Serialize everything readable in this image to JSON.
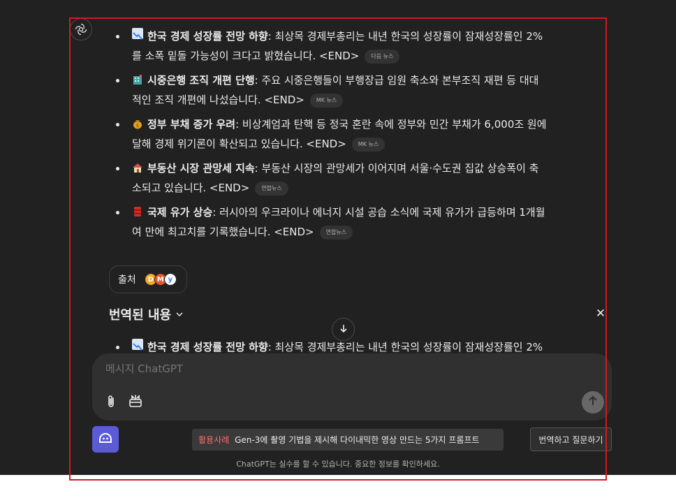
{
  "news_items": [
    {
      "emoji": "chart-decreasing",
      "emoji_color": "#3b82f6",
      "title": "한국 경제 성장률 전망 하향",
      "line1": ": 최상목 경제부총리는 내년 한국의 성장률이 잠재성장률인 2%",
      "line2": "를 소폭 밑돌 가능성이 크다고 밝혔습니다. <END>",
      "source": "다음 뉴스"
    },
    {
      "emoji": "bank-building",
      "emoji_color": "#4aa3a3",
      "title": "시중은행 조직 개편 단행",
      "line1": ": 주요 시중은행들이 부행장급 임원 축소와 본부조직 재편 등 대대",
      "line2": "적인 조직 개편에 나섰습니다. <END>",
      "source": "MK 뉴스"
    },
    {
      "emoji": "money-bag",
      "emoji_color": "#e0a020",
      "title": "정부 부채 증가 우려",
      "line1": ": 비상계엄과 탄핵 등 정국 혼란 속에 정부와 민간 부채가 6,000조 원에",
      "line2": "달해 경제 위기론이 확산되고 있습니다. <END>",
      "source": "MK 뉴스"
    },
    {
      "emoji": "house",
      "emoji_color": "#e8a060",
      "title": "부동산 시장 관망세 지속",
      "line1": ": 부동산 시장의 관망세가 이어지며 서울·수도권 집값 상승폭이 축",
      "line2": "소되고 있습니다. <END>",
      "source": "연합뉴스"
    },
    {
      "emoji": "oil-drum",
      "emoji_color": "#d42a2a",
      "title": "국제 유가 상승",
      "line1": ": 러시아의 우크라이나 에너지 시설 공습 소식에 국제 유가가 급등하며 1개월",
      "line2": "여 만에 최고치를 기록했습니다. <END>",
      "source": "연합뉴스"
    }
  ],
  "sources_label": "출처",
  "favicons": [
    {
      "letter": "D",
      "color": "#f5a623"
    },
    {
      "letter": "M",
      "color": "#e4572e"
    },
    {
      "letter": "y",
      "color": "#1e88e5"
    }
  ],
  "translated": {
    "title": "번역된 내용",
    "first_item": {
      "emoji": "chart-decreasing",
      "title": "한국 경제 성장률 전망 하향",
      "line1": ": 최상목 경제부총리는 내년 한국의 성장률이 잠재성장률인 2%"
    }
  },
  "composer": {
    "placeholder": "메시지 ChatGPT"
  },
  "icons": {
    "avatar": "openai-logo-icon",
    "scroll": "arrow-down-icon",
    "attach": "paperclip-icon",
    "tools": "toolbox-icon",
    "send": "arrow-up-icon",
    "bot": "robot-face-icon",
    "close": "close-icon",
    "chevron": "chevron-down-icon"
  },
  "promo": {
    "tag": "활용사례",
    "text": "Gen-3에 촬영 기법을 제시해 다이내믹한 영상 만드는 5가지 프롬프트"
  },
  "translate_ask_label": "번역하고 질문하기",
  "disclaimer": "ChatGPT는 실수를 할 수 있습니다. 중요한 정보를 확인하세요.",
  "colors": {
    "background": "#212121",
    "composer": "#303030",
    "bot_button": "#5b5bd6",
    "promo_tag": "#ff6b6b",
    "frame": "#d4181e"
  }
}
